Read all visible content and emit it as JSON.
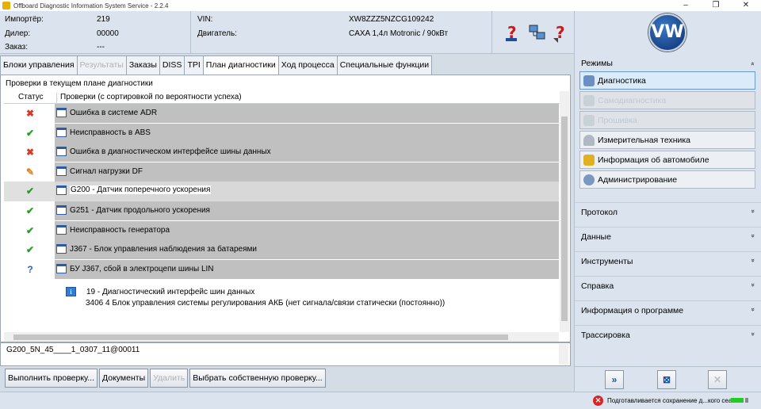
{
  "window": {
    "title": "Offboard Diagnostic Information System Service - 2.2.4",
    "minimize": "–",
    "maximize": "❐",
    "close": "✕"
  },
  "header": {
    "importer_label": "Импортёр:",
    "importer_value": "219",
    "dealer_label": "Дилер:",
    "dealer_value": "00000",
    "order_label": "Заказ:",
    "order_value": "---",
    "vin_label": "VIN:",
    "vin_value": "XW8ZZZ5NZCG109242",
    "engine_label": "Двигатель:",
    "engine_value": "CAXA 1,4л Motronic / 90кВт"
  },
  "brand": {
    "logo": "VW"
  },
  "tabs": [
    {
      "label": "Блоки управления"
    },
    {
      "label": "Результаты"
    },
    {
      "label": "Заказы"
    },
    {
      "label": "DISS"
    },
    {
      "label": "TPI"
    },
    {
      "label": "План диагностики"
    },
    {
      "label": "Ход процесса"
    },
    {
      "label": "Специальные функции"
    }
  ],
  "plan": {
    "section_title": "Проверки в текущем плане диагностики",
    "col_status": "Статус",
    "col_checks": "Проверки (с сортировкой по вероятности успеха)",
    "rows": [
      {
        "status": "✖",
        "label": "Ошибка в системе ADR"
      },
      {
        "status": "✔",
        "label": "Неисправность в ABS"
      },
      {
        "status": "✖",
        "label": "Ошибка в диагностическом интерфейсе шины данных"
      },
      {
        "status": "✎",
        "label": "Сигнал нагрузки DF"
      },
      {
        "status": "✔",
        "label": "G200 - Датчик поперечного ускорения"
      },
      {
        "status": "✔",
        "label": "G251 - Датчик продольного ускорения"
      },
      {
        "status": "✔",
        "label": "Неисправность генератора"
      },
      {
        "status": "✔",
        "label": "J367 - Блок управления наблюдения за батареями"
      },
      {
        "status": "?",
        "label": "БУ J367, сбой в электроцепи шины LIN"
      }
    ],
    "detail": {
      "info_glyph": "i",
      "line1": "19 - Диагностический интерфейс шин данных",
      "line2": "3406   4   Блок управления системы регулирования АКБ  (нет сигнала/связи   статически (постоянно))"
    }
  },
  "code_line": "G200_5N_45____1_0307_11@00011",
  "buttons": {
    "run": "Выполнить проверку...",
    "documents": "Документы",
    "delete": "Удалить",
    "choose": "Выбрать собственную проверку..."
  },
  "right": {
    "modes_title": "Режимы",
    "collapse_glyph": "»",
    "modes": [
      {
        "label": "Диагностика"
      },
      {
        "label": "Самодиагностика"
      },
      {
        "label": "Прошивка"
      },
      {
        "label": "Измерительная техника"
      },
      {
        "label": "Информация об автомобиле"
      },
      {
        "label": "Администрирование"
      }
    ],
    "sections": [
      {
        "label": "Протокол"
      },
      {
        "label": "Данные"
      },
      {
        "label": "Инструменты"
      },
      {
        "label": "Справка"
      },
      {
        "label": "Информация о программе"
      },
      {
        "label": "Трассировка"
      }
    ],
    "expand_glyph": "»"
  },
  "bottom_right": {
    "forward": "»",
    "target": "⊠",
    "cancel": "✕"
  },
  "status_bar": {
    "error_glyph": "✕",
    "message": "Подготавливается сохранение д...кого сеанса."
  }
}
